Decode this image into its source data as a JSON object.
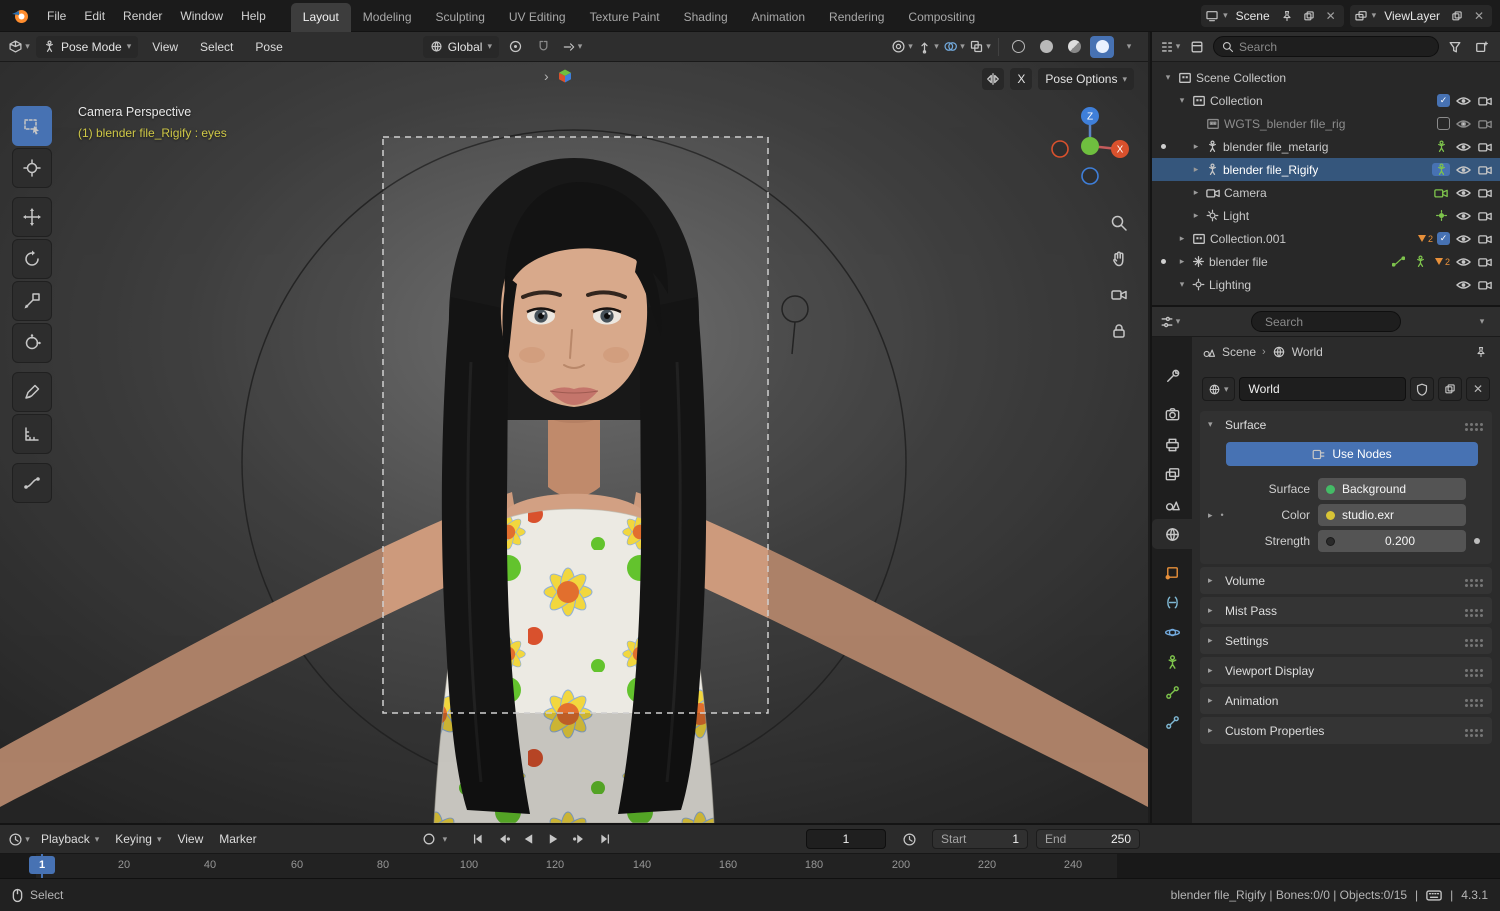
{
  "topbar": {
    "menus": [
      "File",
      "Edit",
      "Render",
      "Window",
      "Help"
    ],
    "workspaces": [
      "Layout",
      "Modeling",
      "Sculpting",
      "UV Editing",
      "Texture Paint",
      "Shading",
      "Animation",
      "Rendering",
      "Compositing"
    ],
    "active_workspace": "Layout",
    "scene_label": "Scene",
    "viewlayer_label": "ViewLayer"
  },
  "tool_header": {
    "mode": "Pose Mode",
    "menus": [
      "View",
      "Select",
      "Pose"
    ],
    "orientation": "Global",
    "mirror_x_label": "X",
    "pose_options_label": "Pose Options"
  },
  "viewport": {
    "view_label": "Camera Perspective",
    "context_label": "(1) blender file_Rigify : eyes",
    "gizmo": {
      "z": "Z",
      "x": "X"
    }
  },
  "outliner": {
    "search_placeholder": "Search",
    "rows": [
      {
        "label": "Scene Collection",
        "icon": "scene-collection-icon"
      },
      {
        "label": "Collection",
        "icon": "collection-icon",
        "checked": true
      },
      {
        "label": "WGTS_blender file_rig",
        "icon": "collection-icon",
        "checked": false
      },
      {
        "label": "blender file_metarig",
        "icon": "armature-icon"
      },
      {
        "label": "blender file_Rigify",
        "icon": "armature-icon",
        "selected": true
      },
      {
        "label": "Camera",
        "icon": "camera-icon"
      },
      {
        "label": "Light",
        "icon": "light-icon"
      },
      {
        "label": "Collection.001",
        "icon": "collection-icon",
        "badge": "2",
        "checked": true
      },
      {
        "label": "blender file",
        "icon": "empty-icon",
        "badge": "2"
      },
      {
        "label": "Lighting",
        "icon": "collection-icon"
      }
    ]
  },
  "properties": {
    "search_placeholder": "Search",
    "breadcrumb": {
      "scene": "Scene",
      "world": "World"
    },
    "datablock_name": "World",
    "tabs": [
      "tool",
      "render",
      "output",
      "view-layer",
      "scene",
      "world",
      "object",
      "constraints",
      "physics",
      "data",
      "bone",
      "bone-constraint"
    ],
    "active_tab": "world",
    "surface_panel": {
      "title": "Surface",
      "use_nodes": "Use Nodes",
      "surface_label": "Surface",
      "surface_value": "Background",
      "color_label": "Color",
      "color_value": "studio.exr",
      "strength_label": "Strength",
      "strength_value": "0.200"
    },
    "panels": [
      "Volume",
      "Mist Pass",
      "Settings",
      "Viewport Display",
      "Animation",
      "Custom Properties"
    ]
  },
  "timeline": {
    "playback": "Playback",
    "keying": "Keying",
    "view": "View",
    "marker": "Marker",
    "current_frame": "1",
    "start_label": "Start",
    "start_value": "1",
    "end_label": "End",
    "end_value": "250",
    "playhead": "1",
    "ticks": [
      "20",
      "40",
      "60",
      "80",
      "100",
      "120",
      "140",
      "160",
      "180",
      "200",
      "220",
      "240"
    ]
  },
  "statusbar": {
    "mode_hint": "Select",
    "info": "blender file_Rigify | Bones:0/0 | Objects:0/15",
    "sep": "|",
    "version": "4.3.1"
  },
  "colors": {
    "accent": "#4772b3",
    "selection": "#35567c",
    "collection_badge": "#e8903a",
    "armature_data": "#7ec44c",
    "context_text": "#cfc846"
  },
  "glyphs": {
    "chevron_down": "▾",
    "chevron_right": "▸",
    "collapse_right": "›",
    "breadcrumb_sep": "›",
    "close": "✕",
    "check": "✓",
    "dot": "•"
  }
}
